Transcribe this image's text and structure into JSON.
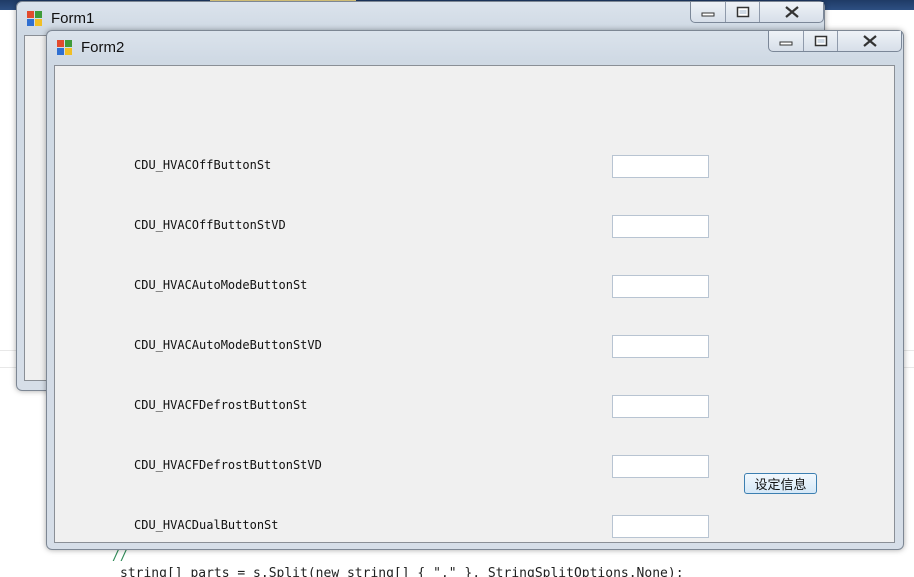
{
  "form1": {
    "title": "Form1"
  },
  "form2": {
    "title": "Form2",
    "rows": [
      {
        "label": "CDU_HVACOffButtonSt",
        "value": ""
      },
      {
        "label": "CDU_HVACOffButtonStVD",
        "value": ""
      },
      {
        "label": "CDU_HVACAutoModeButtonSt",
        "value": ""
      },
      {
        "label": "CDU_HVACAutoModeButtonStVD",
        "value": ""
      },
      {
        "label": "CDU_HVACFDefrostButtonSt",
        "value": ""
      },
      {
        "label": "CDU_HVACFDefrostButtonStVD",
        "value": ""
      },
      {
        "label": "CDU_HVACDualButtonSt",
        "value": ""
      }
    ],
    "set_button_label": "设定信息"
  },
  "background_code": {
    "comment": "//",
    "line": "string[] parts = s.Split(new string[] { \",\" }, StringSplitOptions.None);"
  },
  "icons": {
    "window_icon": "windows-form-icon",
    "minimize": "minimize-icon",
    "maximize": "maximize-icon",
    "close": "close-icon"
  }
}
